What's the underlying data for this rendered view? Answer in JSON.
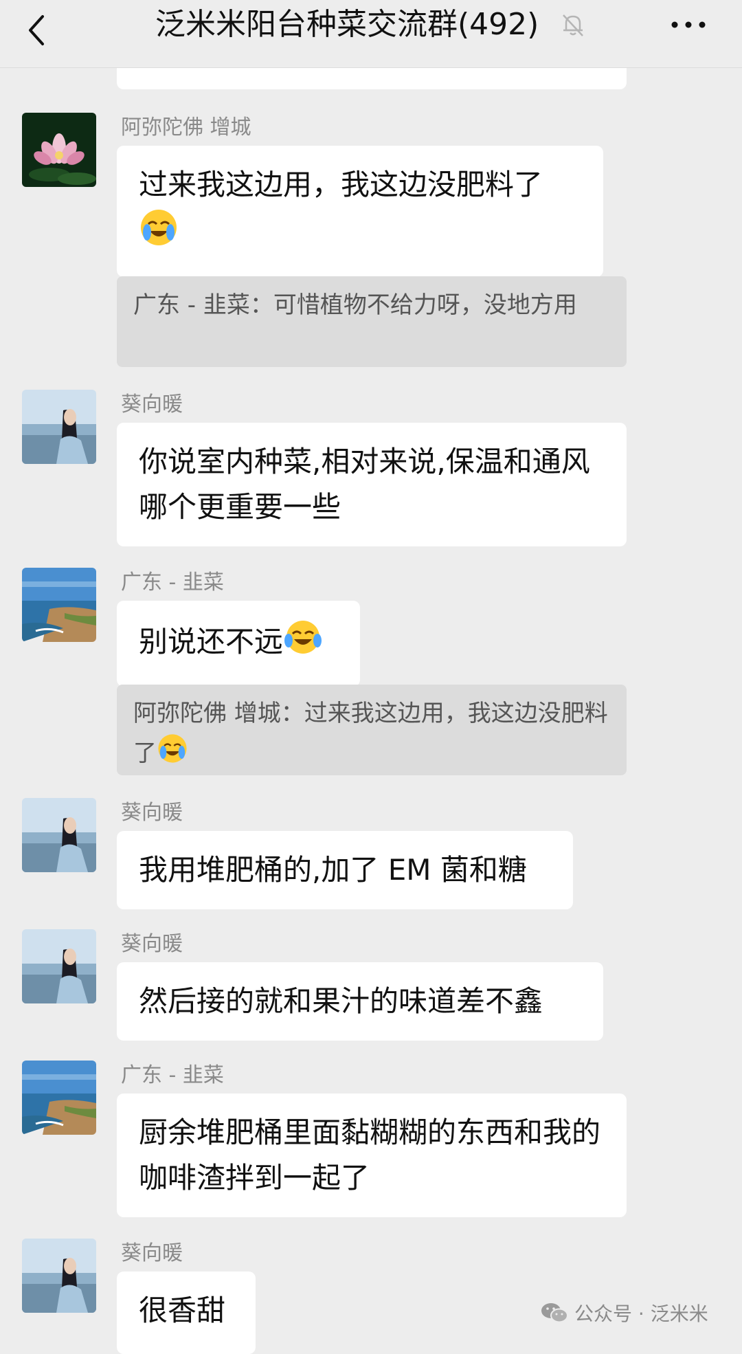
{
  "header": {
    "title": "泛米米阳台种菜交流群(492)",
    "back_icon": "chevron-left-icon",
    "mute_icon": "bell-off-icon",
    "more_icon": "more-dots-icon"
  },
  "messages": [
    {
      "sender": "阿弥陀佛 增城",
      "avatar": "lotus-avatar",
      "text": "过来我这边用，我这边没肥料了",
      "emoji": "crying-laughing-emoji",
      "quote": "广东 - 韭菜：可惜植物不给力呀，没地方用"
    },
    {
      "sender": "葵向暖",
      "avatar": "girl-seaside-avatar",
      "text": "你说室内种菜,相对来说,保温和通风哪个更重要一些"
    },
    {
      "sender": "广东 - 韭菜",
      "avatar": "coast-avatar",
      "text": "别说还不远",
      "emoji": "tears-of-joy-emoji",
      "quote": "阿弥陀佛 增城：过来我这边用，我这边没肥料了",
      "quote_emoji": "crying-laughing-emoji"
    },
    {
      "sender": "葵向暖",
      "avatar": "girl-seaside-avatar",
      "text": "我用堆肥桶的,加了 EM 菌和糖"
    },
    {
      "sender": "葵向暖",
      "avatar": "girl-seaside-avatar",
      "text": "然后接的就和果汁的味道差不鑫"
    },
    {
      "sender": "广东 - 韭菜",
      "avatar": "coast-avatar",
      "text": "厨余堆肥桶里面黏糊糊的东西和我的咖啡渣拌到一起了"
    },
    {
      "sender": "葵向暖",
      "avatar": "girl-seaside-avatar",
      "text": "很香甜"
    }
  ],
  "watermark": {
    "text": "公众号 · 泛米米",
    "icon": "wechat-icon"
  },
  "colors": {
    "background": "#ededed",
    "bubble": "#ffffff",
    "quote_bg": "#dcdcdc",
    "sender_text": "#8a8a8a"
  }
}
